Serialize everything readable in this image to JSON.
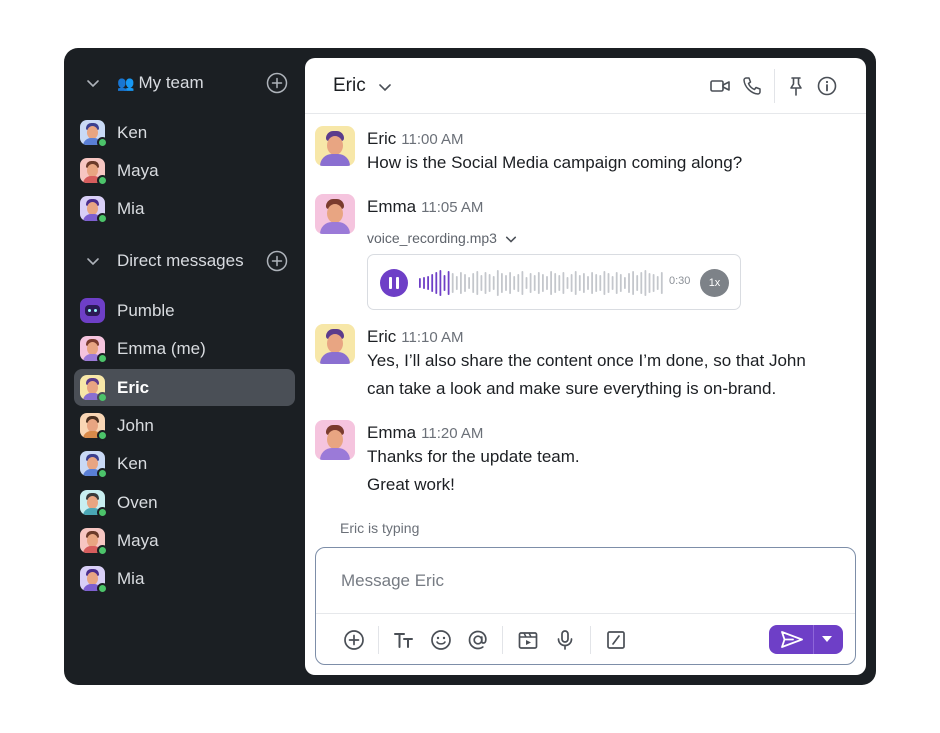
{
  "sidebar": {
    "team_section": {
      "label": "My team",
      "icon": "team-icon",
      "members": [
        {
          "name": "Ken",
          "status": "online"
        },
        {
          "name": "Maya",
          "status": "online"
        },
        {
          "name": "Mia",
          "status": "online"
        }
      ]
    },
    "dm_section": {
      "label": "Direct messages",
      "items": [
        {
          "name": "Pumble",
          "status": "bot"
        },
        {
          "name": "Emma (me)",
          "status": "online"
        },
        {
          "name": "Eric",
          "status": "online",
          "active": true
        },
        {
          "name": "John",
          "status": "online"
        },
        {
          "name": "Ken",
          "status": "online"
        },
        {
          "name": "Oven",
          "status": "online"
        },
        {
          "name": "Maya",
          "status": "online"
        },
        {
          "name": "Mia",
          "status": "online"
        }
      ]
    }
  },
  "header": {
    "title": "Eric",
    "icons": [
      "video-call-icon",
      "phone-icon",
      "pin-icon",
      "info-icon"
    ]
  },
  "messages": [
    {
      "author": "Eric",
      "time": "11:00 AM",
      "lines": [
        "How is the Social Media campaign coming along?"
      ]
    },
    {
      "author": "Emma",
      "time": "11:05 AM",
      "attachment": {
        "filename": "voice_recording.mp3",
        "duration": "0:30",
        "speed": "1x"
      }
    },
    {
      "author": "Eric",
      "time": "11:10 AM",
      "lines": [
        "Yes, I’ll also share the content once I’m done, so that John",
        "can take a look and make sure everything is on-brand."
      ]
    },
    {
      "author": "Emma",
      "time": "11:20 AM",
      "lines": [
        "Thanks for the update team.",
        "Great work!"
      ]
    }
  ],
  "typing_indicator": "Eric is typing",
  "composer": {
    "placeholder": "Message Eric",
    "tools": [
      "add-icon",
      "text-format-icon",
      "emoji-icon",
      "mention-icon",
      "video-clip-icon",
      "microphone-icon",
      "slash-command-icon"
    ],
    "send_icon": "send-icon"
  },
  "colors": {
    "sidebar_bg": "#1b1f23",
    "accent": "#6e3fc7",
    "online": "#4cc36a"
  }
}
